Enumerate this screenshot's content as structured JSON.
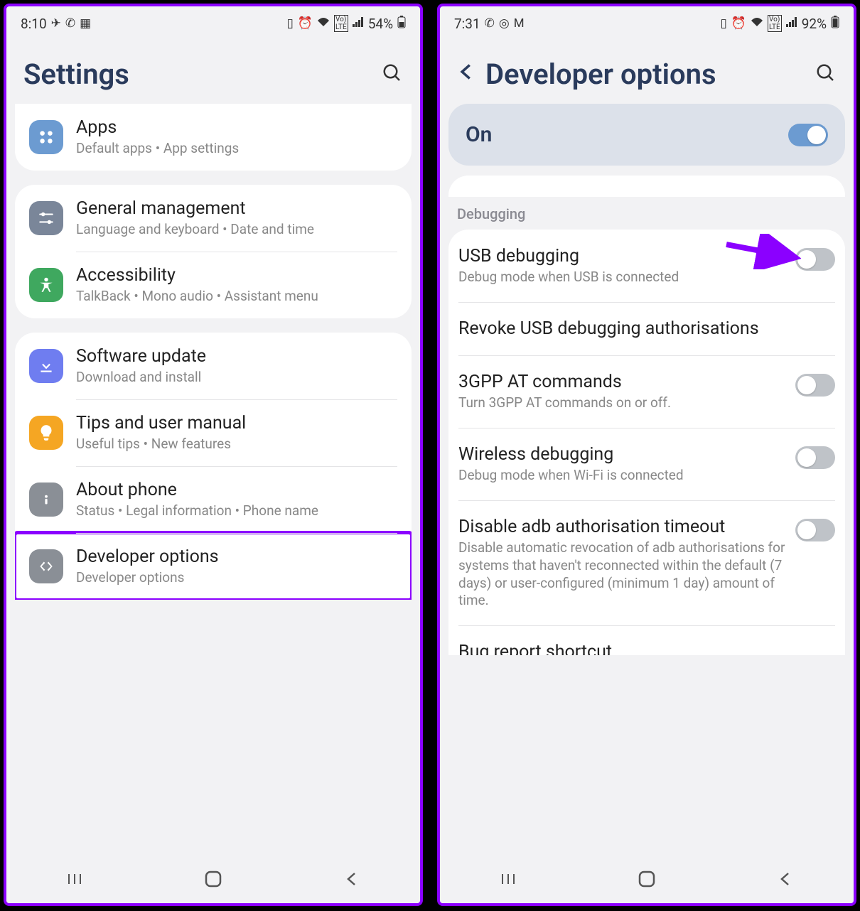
{
  "left": {
    "status": {
      "time": "8:10",
      "battery": "54%"
    },
    "header": {
      "title": "Settings"
    },
    "groups": [
      {
        "rows": [
          {
            "icon": "apps",
            "color": "#6c9bd1",
            "title": "Apps",
            "sub": "Default apps  •  App settings"
          }
        ]
      },
      {
        "rows": [
          {
            "icon": "general",
            "color": "#7a8699",
            "title": "General management",
            "sub": "Language and keyboard  •  Date and time"
          },
          {
            "icon": "accessibility",
            "color": "#3fa85f",
            "title": "Accessibility",
            "sub": "TalkBack  •  Mono audio  •  Assistant menu"
          }
        ]
      },
      {
        "rows": [
          {
            "icon": "update",
            "color": "#6f7df0",
            "title": "Software update",
            "sub": "Download and install"
          },
          {
            "icon": "tips",
            "color": "#f5a623",
            "title": "Tips and user manual",
            "sub": "Useful tips  •  New features"
          },
          {
            "icon": "about",
            "color": "#8a8f96",
            "title": "About phone",
            "sub": "Status  •  Legal information  •  Phone name"
          },
          {
            "icon": "devopts",
            "color": "#8a8f96",
            "title": "Developer options",
            "sub": "Developer options",
            "highlight": true
          }
        ]
      }
    ]
  },
  "right": {
    "status": {
      "time": "7:31",
      "battery": "92%"
    },
    "header": {
      "title": "Developer options"
    },
    "master": {
      "label": "On",
      "on": true
    },
    "section": "Debugging",
    "items": [
      {
        "title": "USB debugging",
        "sub": "Debug mode when USB is connected",
        "toggle": true,
        "on": false,
        "arrow": true
      },
      {
        "title": "Revoke USB debugging authorisations",
        "sub": "",
        "toggle": false
      },
      {
        "title": "3GPP AT commands",
        "sub": "Turn 3GPP AT commands on or off.",
        "toggle": true,
        "on": false
      },
      {
        "title": "Wireless debugging",
        "sub": "Debug mode when Wi-Fi is connected",
        "toggle": true,
        "on": false
      },
      {
        "title": "Disable adb authorisation timeout",
        "sub": "Disable automatic revocation of adb authorisations for systems that haven't reconnected within the default (7 days) or user-configured (minimum 1 day) amount of time.",
        "toggle": true,
        "on": false
      },
      {
        "title": "Bug report shortcut",
        "sub": "",
        "toggle": false,
        "partial": true
      }
    ]
  }
}
